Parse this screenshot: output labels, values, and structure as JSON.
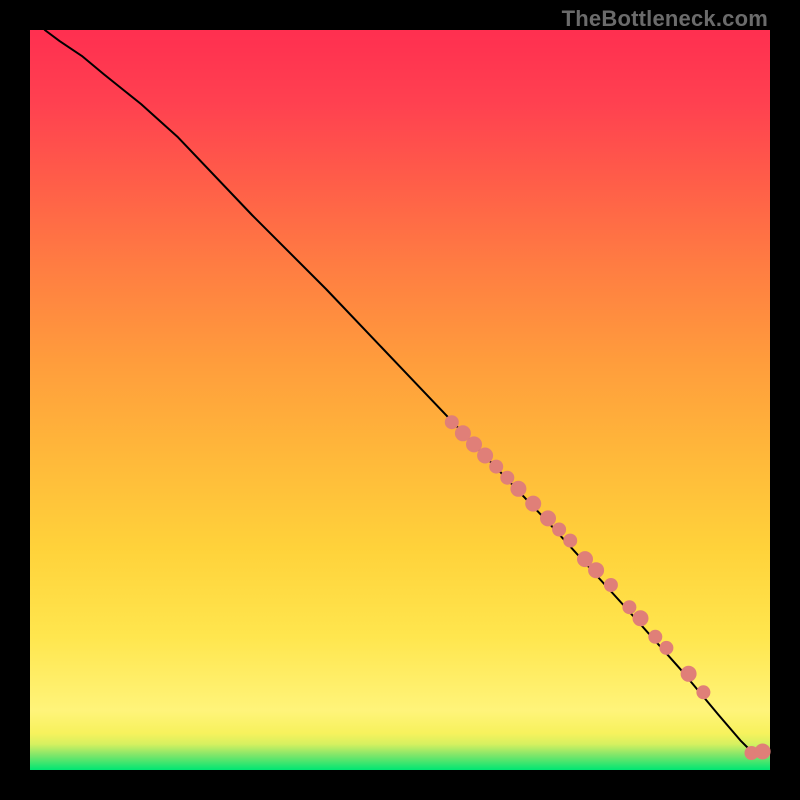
{
  "watermark": "TheBottleneck.com",
  "colors": {
    "point": "#e07f78",
    "line": "#000000"
  },
  "chart_data": {
    "type": "scatter",
    "title": "",
    "xlabel": "",
    "ylabel": "",
    "xlim": [
      0,
      100
    ],
    "ylim": [
      0,
      100
    ],
    "grid": false,
    "legend": false,
    "curve": {
      "description": "Monotone decreasing curve from top-left to bottom-right with a short flattening tail near the bottom-right corner",
      "x": [
        2,
        4,
        7,
        10,
        15,
        20,
        30,
        40,
        50,
        60,
        70,
        80,
        88,
        93,
        96,
        97.5,
        98.5,
        99
      ],
      "y": [
        100,
        98.5,
        96.5,
        94,
        90,
        85.5,
        75,
        65,
        54.5,
        44,
        33.5,
        22.5,
        13.5,
        7.5,
        4,
        2.5,
        2.0,
        2.2
      ]
    },
    "series": [
      {
        "name": "points",
        "color": "#e07f78",
        "x": [
          57,
          58.5,
          60,
          61.5,
          63,
          64.5,
          66,
          68,
          70,
          71.5,
          73,
          75,
          76.5,
          78.5,
          81,
          82.5,
          84.5,
          86,
          89,
          91,
          97.5,
          99
        ],
        "y": [
          47,
          45.5,
          44,
          42.5,
          41,
          39.5,
          38,
          36,
          34,
          32.5,
          31,
          28.5,
          27,
          25,
          22,
          20.5,
          18,
          16.5,
          13,
          10.5,
          2.3,
          2.5
        ],
        "r": [
          7,
          8,
          8,
          8,
          7,
          7,
          8,
          8,
          8,
          7,
          7,
          8,
          8,
          7,
          7,
          8,
          7,
          7,
          8,
          7,
          7,
          8
        ]
      }
    ]
  }
}
